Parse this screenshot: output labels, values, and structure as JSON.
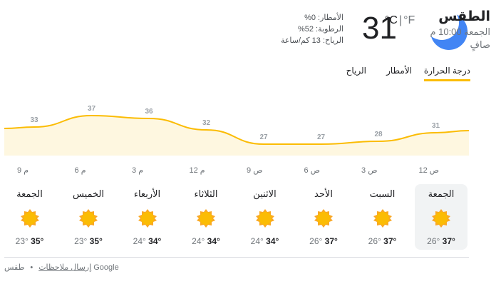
{
  "location": {
    "title": "الطقس",
    "datetime": "الجمعة 10:00 م",
    "condition": "صافٍ"
  },
  "current": {
    "temperature": "31",
    "unit_c": "°C",
    "unit_sep": "|",
    "unit_f": "°F",
    "icon": "moon-icon",
    "rain": "الأمطار: 0%",
    "humidity": "الرطوبة: 52%",
    "wind": "الرياح: 13 كم/ساعة"
  },
  "tabs": [
    {
      "label": "درجة الحرارة",
      "active": true
    },
    {
      "label": "الأمطار",
      "active": false
    },
    {
      "label": "الرياح",
      "active": false
    }
  ],
  "chart_data": {
    "type": "area",
    "x": [
      "9 م",
      "6 م",
      "3 م",
      "12 م",
      "9 ص",
      "6 ص",
      "3 ص",
      "12 ص"
    ],
    "values": [
      33,
      37,
      36,
      32,
      27,
      27,
      28,
      31
    ],
    "value_labels": [
      "33",
      "37",
      "36",
      "32",
      "27",
      "27",
      "28",
      "31"
    ],
    "line_color": "#fbbc04",
    "fill_color": "#fef7e0",
    "grid": false
  },
  "forecast": [
    {
      "day": "الجمعة",
      "icon": "sun-icon",
      "high": "37",
      "low": "26°",
      "selected": true
    },
    {
      "day": "السبت",
      "icon": "sun-icon",
      "high": "37",
      "low": "26°",
      "selected": false
    },
    {
      "day": "الأحد",
      "icon": "sun-icon",
      "high": "37",
      "low": "26°",
      "selected": false
    },
    {
      "day": "الاثنين",
      "icon": "sun-icon",
      "high": "34",
      "low": "24°",
      "selected": false
    },
    {
      "day": "الثلاثاء",
      "icon": "sun-icon",
      "high": "34",
      "low": "24°",
      "selected": false
    },
    {
      "day": "الأربعاء",
      "icon": "sun-icon",
      "high": "34",
      "low": "24°",
      "selected": false
    },
    {
      "day": "الخميس",
      "icon": "sun-icon",
      "high": "35",
      "low": "23°",
      "selected": false
    },
    {
      "day": "الجمعة",
      "icon": "sun-icon",
      "high": "35",
      "low": "23°",
      "selected": false
    }
  ],
  "footer": {
    "feedback": "إرسال ملاحظات",
    "dot": "•",
    "source": "طقس Google"
  },
  "colors": {
    "accent": "#fbbc04",
    "moon": "#4285f4",
    "sun": "#f9a825"
  }
}
